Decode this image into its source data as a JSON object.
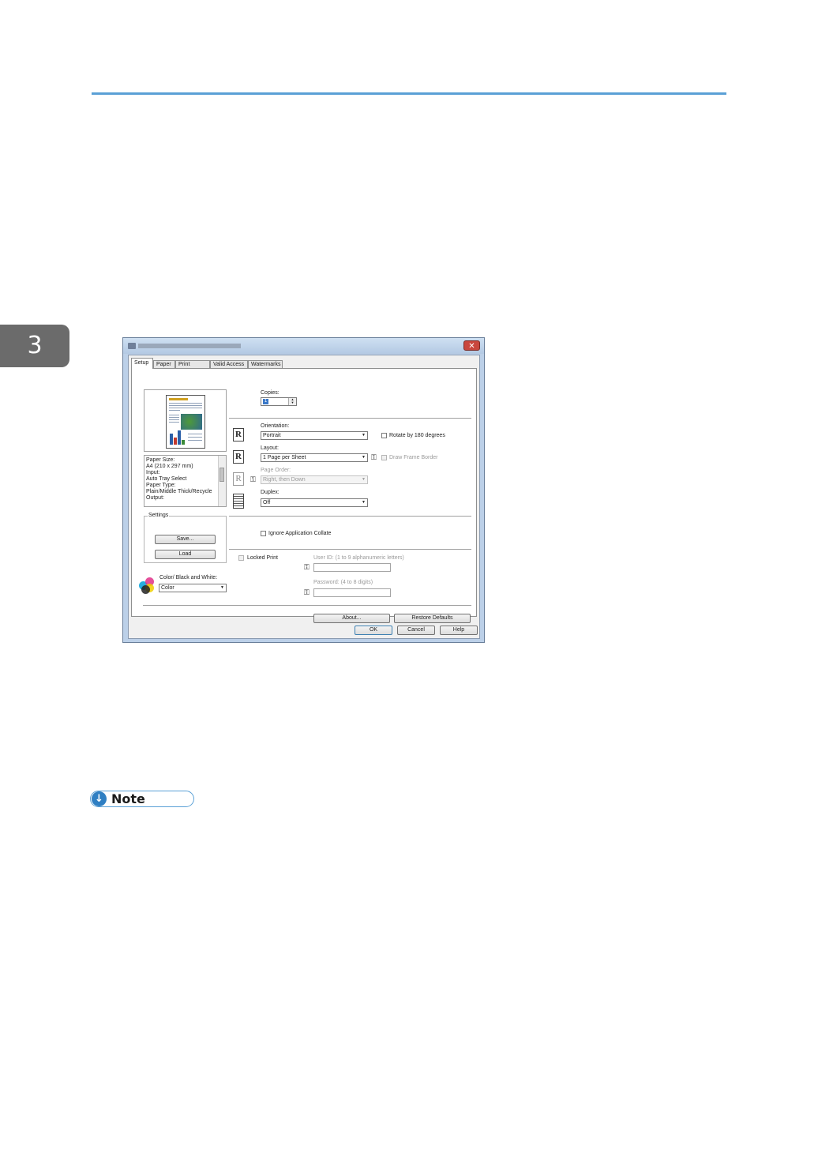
{
  "page": {
    "chapter_number": "3",
    "note_label": "Note",
    "note_icon": "down-arrow-circle-icon"
  },
  "dialog": {
    "tabs": [
      "Setup",
      "Paper",
      "Print Quality",
      "Valid Access",
      "Watermarks"
    ],
    "copies_label": "Copies:",
    "copies_value": "1",
    "orientation_label": "Orientation:",
    "orientation_value": "Portrait",
    "rotate_label": "Rotate by 180 degrees",
    "layout_label": "Layout:",
    "layout_value": "1 Page per Sheet",
    "frame_border_label": "Draw Frame Border",
    "page_order_label": "Page Order:",
    "page_order_value": "Right, then Down",
    "duplex_label": "Duplex:",
    "duplex_value": "Off",
    "ignore_collate_label": "Ignore Application Collate",
    "locked_print_label": "Locked Print",
    "user_id_label": "User ID: (1 to 9 alphanumeric letters)",
    "password_label": "Password: (4 to 8 digits)",
    "summary": [
      "Paper Size:",
      "  A4 (210 x 297 mm)",
      "Input:",
      "  Auto Tray Select",
      "Paper Type:",
      "  Plain/Middle Thick/Recycle",
      "Output:"
    ],
    "settings_label": "Settings",
    "save_label": "Save...",
    "load_label": "Load",
    "color_bw_label": "Color/ Black and White:",
    "color_value": "Color",
    "about_label": "About...",
    "restore_label": "Restore Defaults",
    "ok_label": "OK",
    "cancel_label": "Cancel",
    "help_label": "Help",
    "close_symbol": "✕",
    "orientation_icon_letter": "R"
  }
}
